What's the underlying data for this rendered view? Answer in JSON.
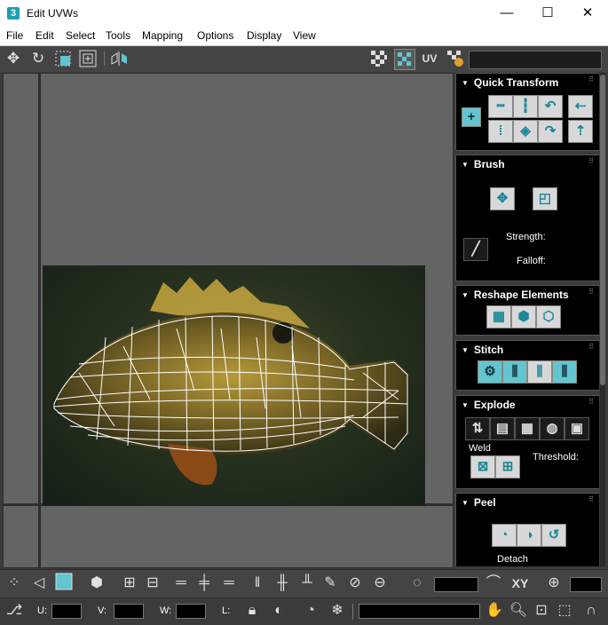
{
  "window": {
    "app_icon_text": "3",
    "title": "Edit UVWs",
    "minimize": "—",
    "maximize": "☐",
    "close": "✕"
  },
  "menu": [
    "File",
    "Edit",
    "Select",
    "Tools",
    "Mapping",
    "Options",
    "Display",
    "View"
  ],
  "toolbar": {
    "uv_label": "UV",
    "icons": [
      "move-icon",
      "rotate-icon",
      "scale-icon",
      "freeform-icon",
      "mirror-icon",
      "checker-icon",
      "texture-checker-icon",
      "uv-editor-icon"
    ]
  },
  "panel": {
    "quick_transform": {
      "title": "Quick Transform"
    },
    "brush": {
      "title": "Brush",
      "strength_label": "Strength:",
      "falloff_label": "Falloff:"
    },
    "reshape": {
      "title": "Reshape Elements"
    },
    "stitch": {
      "title": "Stitch"
    },
    "explode": {
      "title": "Explode",
      "weld_label": "Weld",
      "threshold_label": "Threshold:"
    },
    "peel": {
      "title": "Peel",
      "detach_label": "Detach"
    }
  },
  "bottom": {
    "xy_label": "XY",
    "u_label": "U:",
    "v_label": "V:",
    "w_label": "W:",
    "l_label": "L:"
  },
  "colors": {
    "accent": "#63c5d0",
    "panel_bg": "#000000",
    "viewport_bg": "#646464",
    "toolbar_bg": "#444444"
  }
}
